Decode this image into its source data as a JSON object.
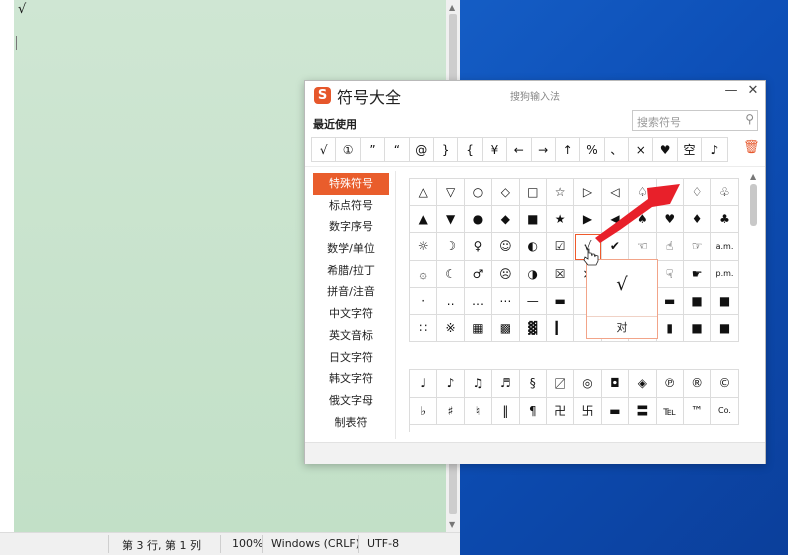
{
  "notepad": {
    "content": "√",
    "status": {
      "position": "第 3 行, 第 1 列",
      "zoom": "100%",
      "line_ending": "Windows (CRLF)",
      "encoding": "UTF-8"
    }
  },
  "dialog": {
    "title": "符号大全",
    "subtitle": "搜狗输入法",
    "logo_letter": "S",
    "minimize": "—",
    "close": "✕",
    "recent_label": "最近使用",
    "search_placeholder": "搜索符号",
    "search_icon": "magnifier-icon",
    "trash_icon": "trash-icon",
    "recent": [
      "√",
      "①",
      "”",
      "“",
      "@",
      "}",
      "{",
      "¥",
      "←",
      "→",
      "↑",
      "%",
      "、",
      "×",
      "♥",
      "空",
      "♪"
    ],
    "categories": [
      "特殊符号",
      "标点符号",
      "数字序号",
      "数学/单位",
      "希腊/拉丁",
      "拼音/注音",
      "中文字符",
      "英文音标",
      "日文字符",
      "韩文字符",
      "俄文字母",
      "制表符"
    ],
    "active_category": "特殊符号",
    "grid_top": [
      [
        "△",
        "▽",
        "○",
        "◇",
        "□",
        "☆",
        "▷",
        "◁",
        "♤",
        "♡",
        "♢",
        "♧"
      ],
      [
        "▲",
        "▼",
        "●",
        "◆",
        "■",
        "★",
        "▶",
        "◀",
        "♠",
        "♥",
        "♦",
        "♣"
      ],
      [
        "☼",
        "☽",
        "♀",
        "☺",
        "◐",
        "☑",
        "√",
        "✔",
        "☜",
        "☝",
        "☞",
        "a.m."
      ],
      [
        "۞",
        "☾",
        "♂",
        "☹",
        "◑",
        "☒",
        "×",
        "✘",
        "☚",
        "☟",
        "☛",
        "p.m."
      ],
      [
        "·",
        "‥",
        "…",
        "⋯",
        "—",
        "▬",
        "",
        "",
        "",
        "▬",
        "■",
        "■"
      ],
      [
        "∷",
        "※",
        "▦",
        "▩",
        "▓",
        "▎",
        "",
        "",
        "",
        "▮",
        "■",
        "■"
      ]
    ],
    "grid_bottom": [
      [
        "♩",
        "♪",
        "♫",
        "♬",
        "§",
        "〼",
        "◎",
        "◘",
        "◈",
        "℗",
        "®",
        "©"
      ],
      [
        "♭",
        "♯",
        "♮",
        "‖",
        "¶",
        "卍",
        "卐",
        "▬",
        "〓",
        "℡",
        "™",
        "Co."
      ]
    ],
    "popup": {
      "symbol": "√",
      "label": "对"
    }
  }
}
